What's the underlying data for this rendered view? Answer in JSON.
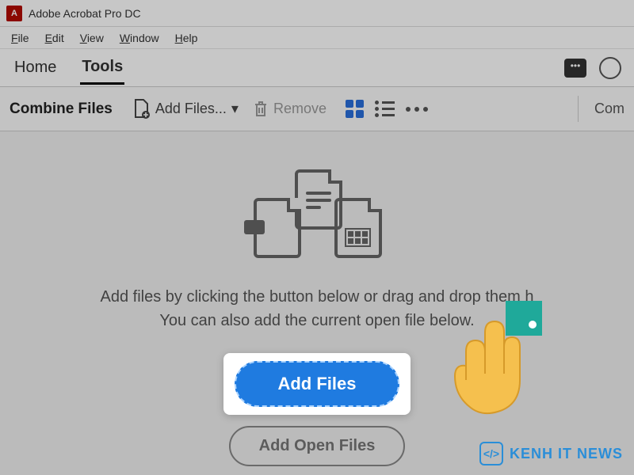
{
  "app": {
    "title": "Adobe Acrobat Pro DC"
  },
  "menubar": {
    "file": "File",
    "edit": "Edit",
    "view": "View",
    "window": "Window",
    "help": "Help"
  },
  "tabs": {
    "home": "Home",
    "tools": "Tools"
  },
  "toolbar": {
    "title": "Combine Files",
    "add_files": "Add Files...",
    "remove": "Remove",
    "combine_cut": "Com"
  },
  "main": {
    "instruction_line1": "Add files by clicking the button below or drag and drop them h",
    "instruction_line2": "You can also add the current open file            below.",
    "add_files_btn": "Add Files",
    "add_open_btn": "Add Open Files"
  },
  "watermark": {
    "text": "KENH IT NEWS"
  }
}
